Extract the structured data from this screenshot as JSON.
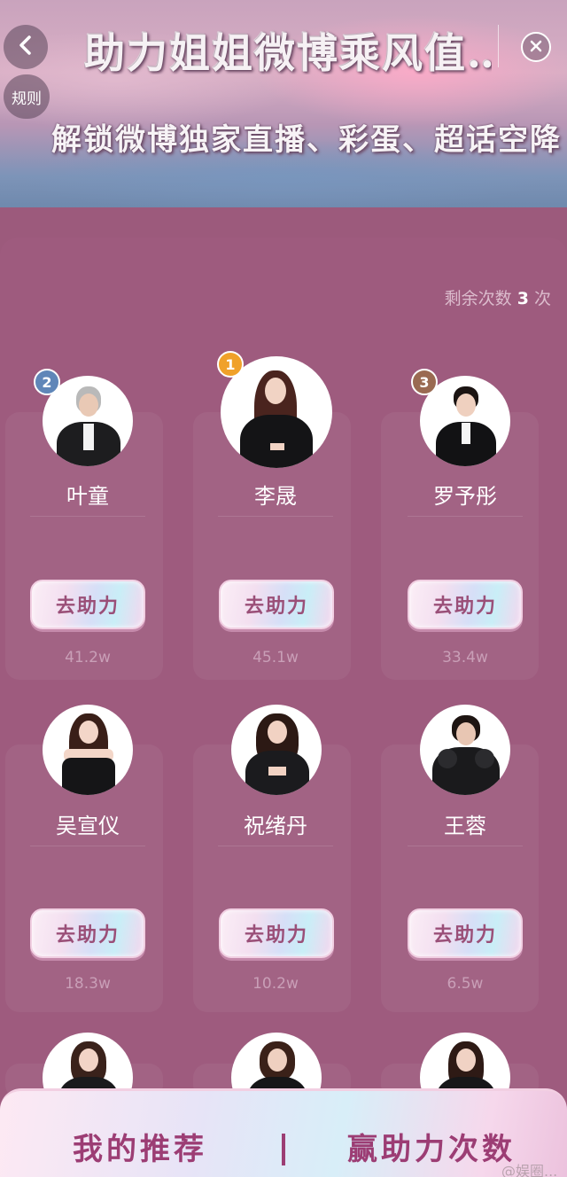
{
  "header": {
    "title": "助力姐姐微博乘风值…",
    "subtitle": "解锁微博独家直播、彩蛋、超话空降",
    "back_icon": "chevron-left-icon",
    "rules_label": "规则",
    "close_icon": "close-icon"
  },
  "remaining": {
    "label": "剩余次数",
    "count": "3",
    "unit": "次"
  },
  "contestants": [
    {
      "name": "叶童",
      "rank": "2",
      "rank_color": "#5f86b8",
      "button": "去助力",
      "votes": "41.2w"
    },
    {
      "name": "李晟",
      "rank": "1",
      "rank_color": "#f0a12a",
      "button": "去助力",
      "votes": "45.1w"
    },
    {
      "name": "罗予彤",
      "rank": "3",
      "rank_color": "#9a6a52",
      "button": "去助力",
      "votes": "33.4w"
    },
    {
      "name": "吴宣仪",
      "button": "去助力",
      "votes": "18.3w"
    },
    {
      "name": "祝绪丹",
      "button": "去助力",
      "votes": "10.2w"
    },
    {
      "name": "王蓉",
      "button": "去助力",
      "votes": "6.5w"
    },
    {
      "name": "",
      "button": "",
      "votes": ""
    },
    {
      "name": "",
      "button": "",
      "votes": ""
    },
    {
      "name": "",
      "button": "",
      "votes": ""
    }
  ],
  "bottom_bar": {
    "left_label": "我的推荐",
    "separator": "|",
    "right_label": "赢助力次数"
  },
  "watermark": "@娱圈..."
}
